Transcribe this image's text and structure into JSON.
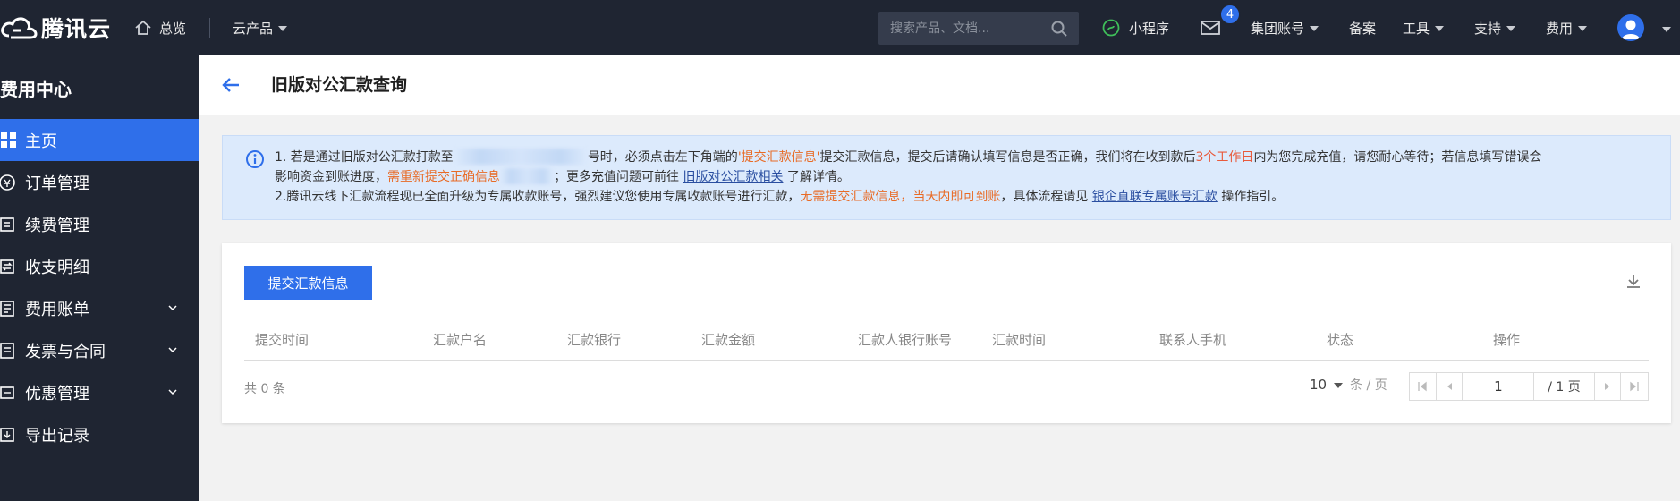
{
  "topnav": {
    "logo_text": "腾讯云",
    "home_label": "总览",
    "products_label": "云产品",
    "search_placeholder": "搜索产品、文档...",
    "mini_program_label": "小程序",
    "mail_badge": "4",
    "group_account_label": "集团账号",
    "beian_label": "备案",
    "tools_label": "工具",
    "support_label": "支持",
    "fee_label": "费用"
  },
  "sidebar": {
    "title": "费用中心",
    "items": [
      {
        "label": "主页",
        "icon": "grid-icon",
        "active": true
      },
      {
        "label": "订单管理",
        "icon": "order-icon"
      },
      {
        "label": "续费管理",
        "icon": "renew-icon"
      },
      {
        "label": "收支明细",
        "icon": "transfer-icon"
      },
      {
        "label": "费用账单",
        "icon": "bill-icon",
        "expandable": true
      },
      {
        "label": "发票与合同",
        "icon": "invoice-icon",
        "expandable": true
      },
      {
        "label": "优惠管理",
        "icon": "coupon-icon",
        "expandable": true
      },
      {
        "label": "导出记录",
        "icon": "export-icon"
      }
    ]
  },
  "header": {
    "title": "旧版对公汇款查询"
  },
  "notice": {
    "line1_a": "1. 若是通过旧版对公汇款打款至",
    "line1_b": "号时，必须点击左下角端的",
    "line1_highlight1": "'提交汇款信息'",
    "line1_c": "提交汇款信息，提交后请确认填写信息是否正确，我们将在收到款后",
    "line1_highlight2": "3个工作日",
    "line1_d": "内为您完成充值，请您耐心等待；若信息填写错误会",
    "line2_a": "影响资金到账进度，",
    "line2_highlight": "需重新提交正确信息",
    "line2_b": "；更多充值问题可前往",
    "line2_link": "旧版对公汇款相关",
    "line2_c": "了解详情。",
    "line3_a": "2.腾讯云线下汇款流程现已全面升级为专属收款账号，强烈建议您使用专属收款账号进行汇款，",
    "line3_highlight": "无需提交汇款信息，当天内即可到账",
    "line3_b": "，具体流程请见",
    "line3_link": "银企直联专属账号汇款",
    "line3_c": "操作指引。"
  },
  "table": {
    "submit_button": "提交汇款信息",
    "columns": [
      "提交时间",
      "汇款户名",
      "汇款银行",
      "汇款金额",
      "汇款人银行账号",
      "汇款时间",
      "联系人手机",
      "状态",
      "操作"
    ],
    "total_text": "共 0 条",
    "page_size": "10",
    "page_size_unit": "条 / 页",
    "current_page": "1",
    "total_pages": "/ 1 页"
  },
  "colors": {
    "nav_bg": "#1f2532",
    "accent": "#2f6fea",
    "notice_bg": "#dceafc",
    "highlight_orange": "#e86b26"
  }
}
